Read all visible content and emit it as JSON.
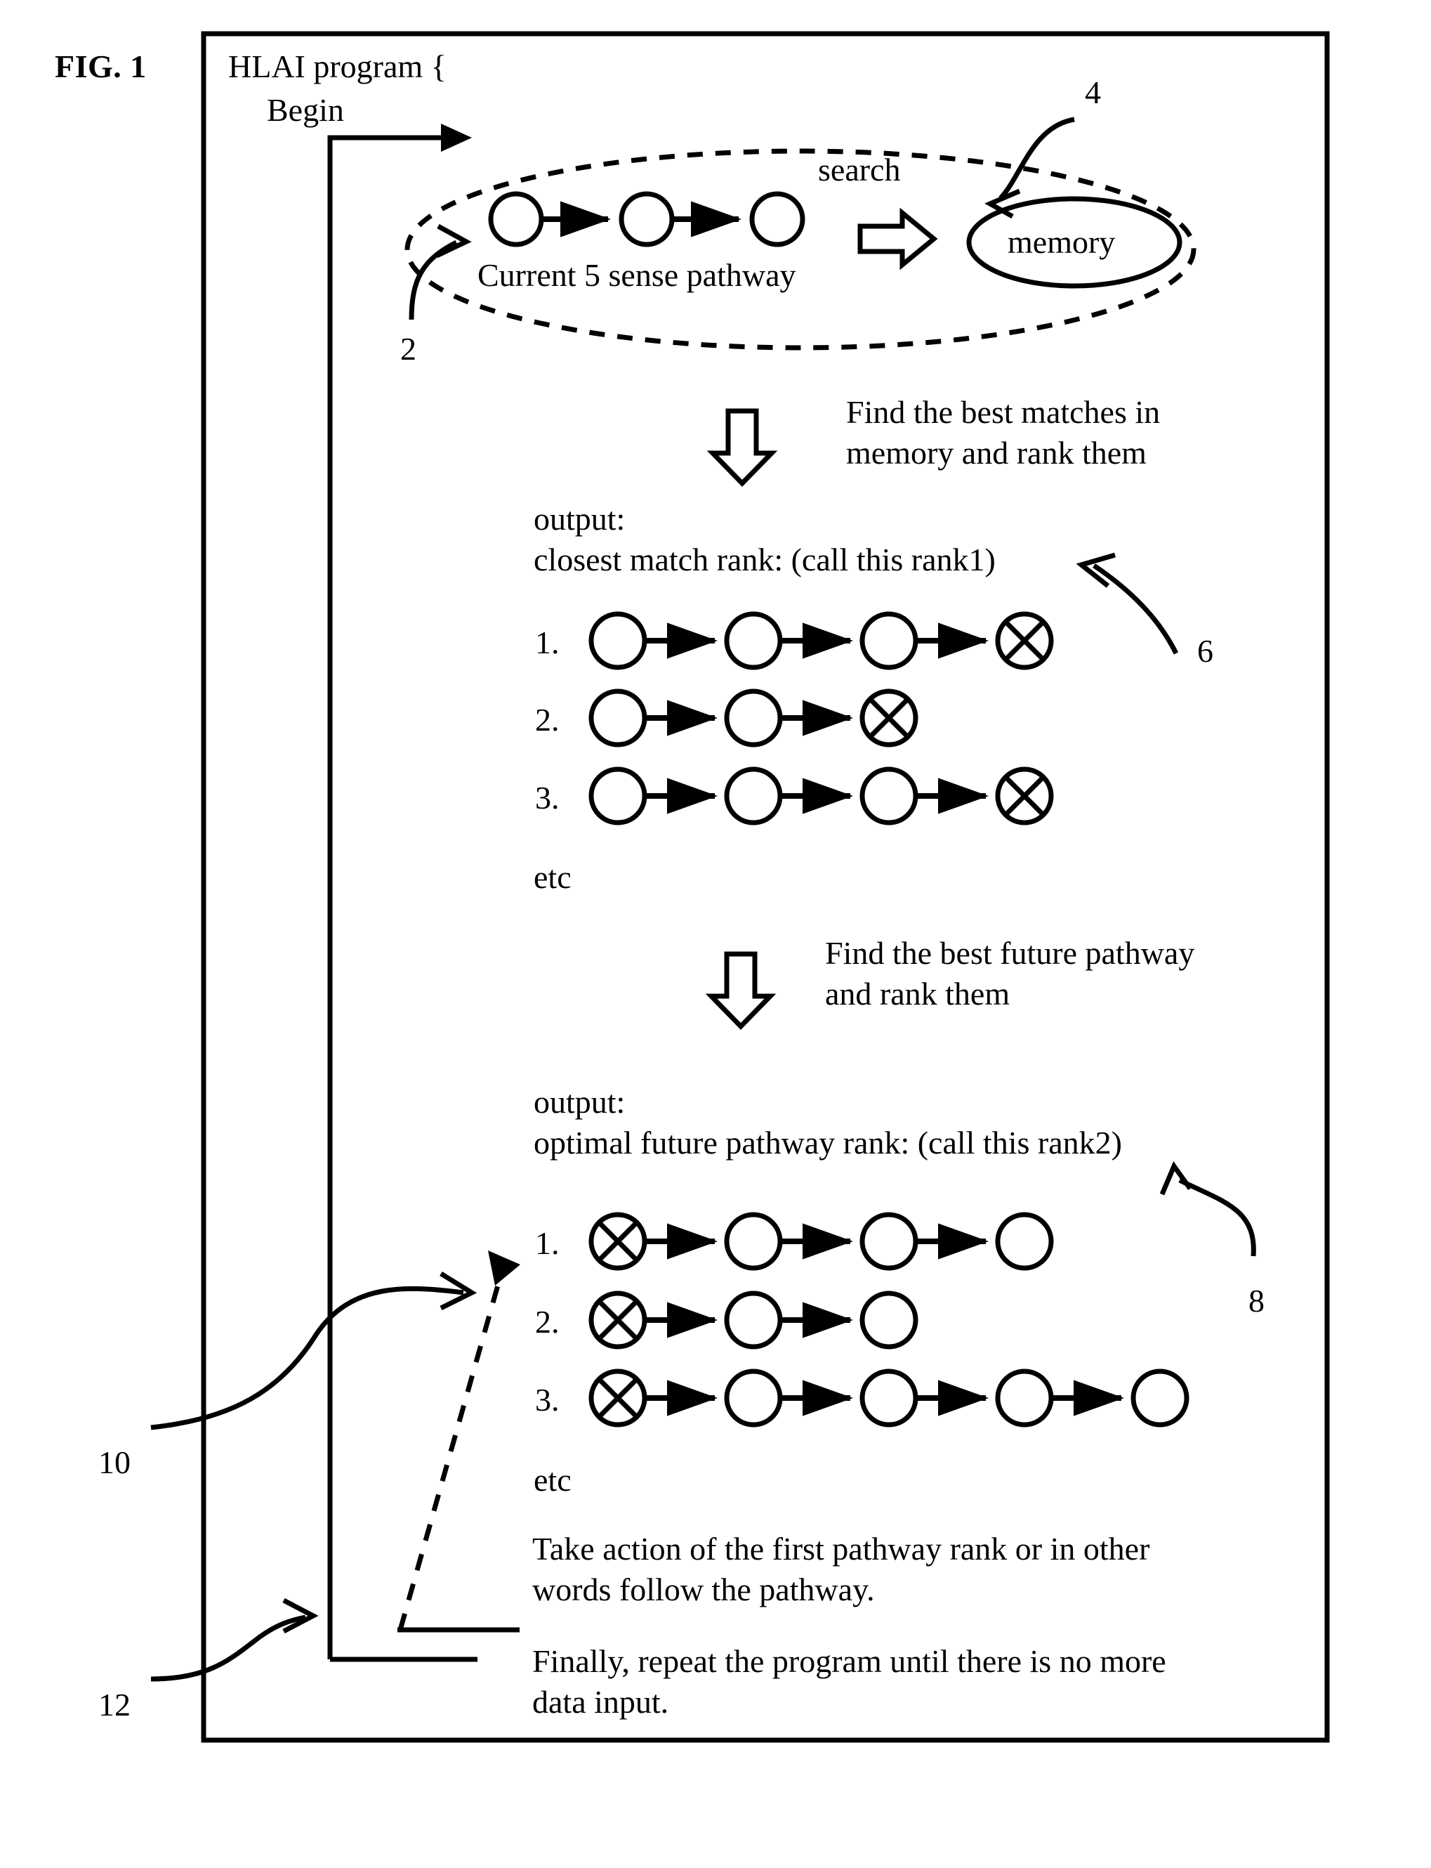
{
  "figure": {
    "label": "FIG. 1",
    "title_line1": "HLAI program {",
    "title_line2": "Begin"
  },
  "search_stage": {
    "search_label": "search",
    "pathway_caption": "Current 5 sense pathway",
    "memory_label": "memory",
    "pathway_node_count": 3,
    "callout_2": "2",
    "callout_4": "4"
  },
  "step1": {
    "arrow": "down-arrow",
    "text_line1": "Find the best matches in",
    "text_line2": "memory and rank them"
  },
  "rank1": {
    "output_label": "output:",
    "heading": "closest match rank: (call this rank1)",
    "callout_6": "6",
    "etc": "etc",
    "rows": [
      {
        "index": "1.",
        "nodes": [
          "circle",
          "circle",
          "circle",
          "crossed"
        ]
      },
      {
        "index": "2.",
        "nodes": [
          "circle",
          "circle",
          "crossed"
        ]
      },
      {
        "index": "3.",
        "nodes": [
          "circle",
          "circle",
          "circle",
          "crossed"
        ]
      }
    ]
  },
  "step2": {
    "arrow": "down-arrow",
    "text_line1": "Find the best future pathway",
    "text_line2": "and rank them"
  },
  "rank2": {
    "output_label": "output:",
    "heading": "optimal future pathway rank: (call this rank2)",
    "callout_8": "8",
    "callout_10": "10",
    "etc": "etc",
    "rows": [
      {
        "index": "1.",
        "nodes": [
          "crossed",
          "circle",
          "circle",
          "circle"
        ]
      },
      {
        "index": "2.",
        "nodes": [
          "crossed",
          "circle",
          "circle"
        ]
      },
      {
        "index": "3.",
        "nodes": [
          "crossed",
          "circle",
          "circle",
          "circle",
          "circle"
        ]
      }
    ]
  },
  "action": {
    "text_line1": "Take action of the first pathway rank or in other",
    "text_line2": "words follow the pathway."
  },
  "repeat": {
    "text_line1": "Finally, repeat the program until there is no more",
    "text_line2": "data input.",
    "callout_12": "12"
  },
  "colors": {
    "ink": "#000000",
    "paper": "#ffffff"
  }
}
